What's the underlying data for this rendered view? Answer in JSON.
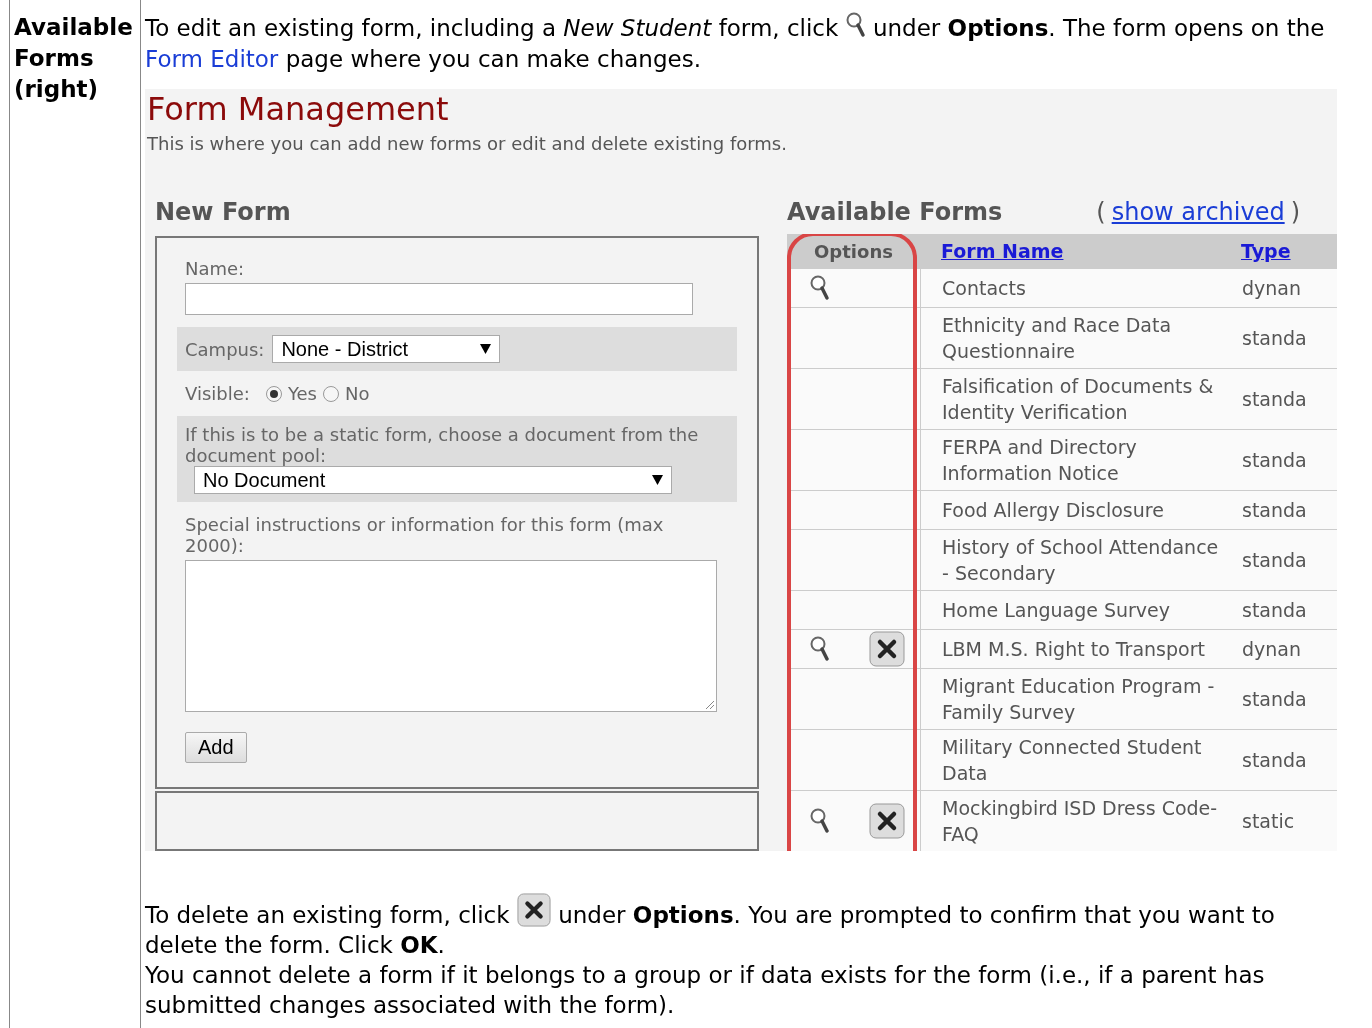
{
  "doc_table": {
    "header_cell": "Available Forms (right)",
    "intro": {
      "before_icon": "To edit an existing form, including a *New Student* form, click",
      "after_icon": "under **Options**. The form opens on the",
      "link": "Form Editor",
      "after_link": "page where you can make changes."
    },
    "screenshot": {
      "title": "Form Management",
      "subtitle": "This is where you can add new forms or edit and delete existing forms.",
      "new_form": {
        "heading": "New Form",
        "name_label": "Name:",
        "campus_label": "Campus:",
        "campus_value": "None - District",
        "visible_label": "Visible:",
        "visible_options": [
          {
            "label": "Yes",
            "selected": true
          },
          {
            "label": "No",
            "selected": false
          }
        ],
        "document_label": "If this is to be a static form, choose a document from the document pool:",
        "document_value": "No Document",
        "instructions_label": "Special instructions or information for this form (max 2000):",
        "add_button": "Add"
      },
      "available_forms": {
        "heading": "Available Forms",
        "open_paren": "(",
        "show_archived_link": "show archived",
        "close_paren": ")",
        "columns": [
          "Options",
          "Form Name",
          "Type"
        ],
        "rows": [
          {
            "view": true,
            "delete": false,
            "name": "Contacts",
            "type": "dynan"
          },
          {
            "view": false,
            "delete": false,
            "name": "Ethnicity and Race Data Questionnaire",
            "type": "standa"
          },
          {
            "view": false,
            "delete": false,
            "name": "Falsification of Documents & Identity Verification",
            "type": "standa"
          },
          {
            "view": false,
            "delete": false,
            "name": "FERPA and Directory Information Notice",
            "type": "standa"
          },
          {
            "view": false,
            "delete": false,
            "name": "Food Allergy Disclosure",
            "type": "standa"
          },
          {
            "view": false,
            "delete": false,
            "name": "History of School Attendance - Secondary",
            "type": "standa"
          },
          {
            "view": false,
            "delete": false,
            "name": "Home Language Survey",
            "type": "standa"
          },
          {
            "view": true,
            "delete": true,
            "name": "LBM M.S. Right to Transport",
            "type": "dynan"
          },
          {
            "view": false,
            "delete": false,
            "name": "Migrant Education Program - Family Survey",
            "type": "standa"
          },
          {
            "view": false,
            "delete": false,
            "name": "Military Connected Student Data",
            "type": "standa"
          },
          {
            "view": true,
            "delete": true,
            "name": "Mockingbird ISD Dress Code-FAQ",
            "type": "static"
          }
        ]
      }
    },
    "delete_note": {
      "before_icon": "To delete an existing form, click",
      "after_icon": "under **Options**. You are prompted to confirm that you want to",
      "continuation": "delete the form. Click **OK**."
    },
    "restriction_note": "You cannot delete a form if it belongs to a group or if data exists for the form (i.e., if a parent has submitted changes associated with the form)."
  }
}
